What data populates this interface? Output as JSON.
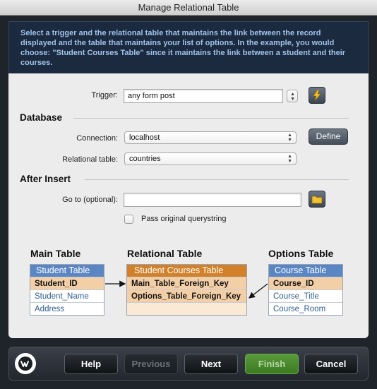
{
  "window": {
    "title": "Manage Relational Table"
  },
  "intro": {
    "text": "Select a trigger and the relational table that maintains the link between the record displayed and the table that maintains your list of options. In the example, you would choose: \"Student Courses Table\" since it maintains the link between a student and their courses."
  },
  "trigger": {
    "label": "Trigger:",
    "value": "any form post"
  },
  "database": {
    "heading": "Database",
    "connection_label": "Connection:",
    "connection_value": "localhost",
    "define_label": "Define",
    "relational_label": "Relational table:",
    "relational_value": "countries"
  },
  "after_insert": {
    "heading": "After Insert",
    "goto_label": "Go to (optional):",
    "goto_value": "",
    "pass_label": "Pass original querystring",
    "pass_checked": false
  },
  "diagram": {
    "main": {
      "title": "Main Table",
      "header": "Student Table",
      "rows": [
        "Student_ID",
        "Student_Name",
        "Address"
      ]
    },
    "relational": {
      "title": "Relational Table",
      "header": "Student Courses Table",
      "rows": [
        "Main_Table_Foreign_Key",
        "Options_Table_Foreign_Key",
        ""
      ]
    },
    "options": {
      "title": "Options Table",
      "header": "Course Table",
      "rows": [
        "Course_ID",
        "Course_Title",
        "Course_Room"
      ]
    },
    "colors": {
      "blue_header": "#5b86c4",
      "orange_header": "#d2812a",
      "key_row": "#f3cfa7"
    }
  },
  "footer": {
    "help": "Help",
    "previous": "Previous",
    "next": "Next",
    "finish": "Finish",
    "cancel": "Cancel"
  }
}
